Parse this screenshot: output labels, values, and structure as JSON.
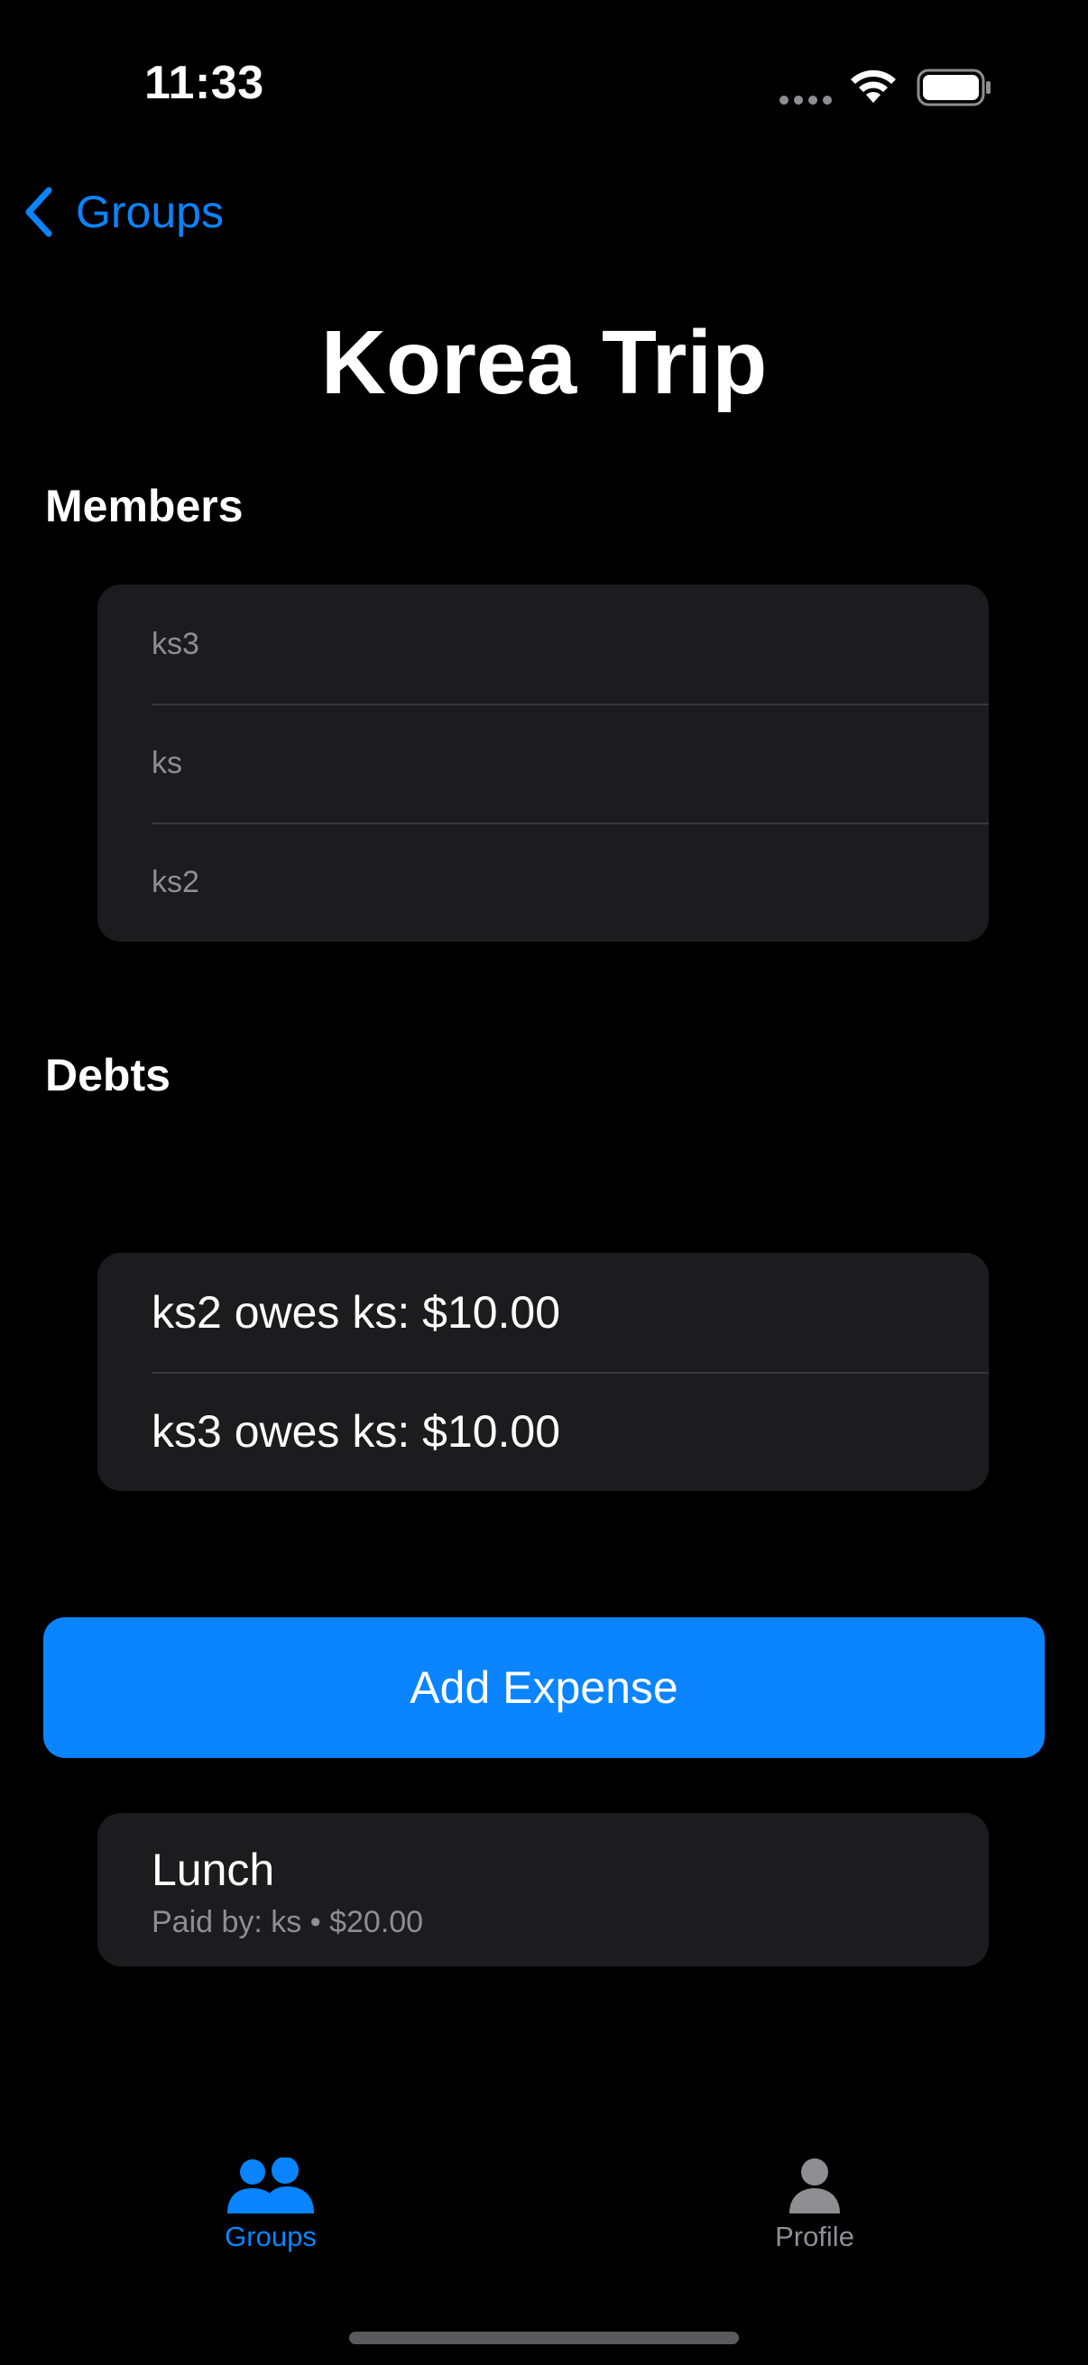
{
  "status_bar": {
    "time": "11:33"
  },
  "nav": {
    "back_label": "Groups"
  },
  "page": {
    "title": "Korea Trip"
  },
  "members": {
    "heading": "Members",
    "items": [
      "ks3",
      "ks",
      "ks2"
    ]
  },
  "debts": {
    "heading": "Debts",
    "items": [
      "ks2 owes ks: $10.00",
      "ks3 owes ks: $10.00"
    ]
  },
  "actions": {
    "add_expense_label": "Add Expense"
  },
  "expenses": [
    {
      "title": "Lunch",
      "subtitle": "Paid by: ks • $20.00"
    }
  ],
  "tab_bar": {
    "tabs": [
      {
        "label": "Groups",
        "icon": "people-icon",
        "active": true
      },
      {
        "label": "Profile",
        "icon": "person-icon",
        "active": false
      }
    ]
  },
  "colors": {
    "accent": "#0a84ff",
    "card": "#1c1c1e",
    "secondary_text": "#8e8e93",
    "background": "#000000"
  }
}
